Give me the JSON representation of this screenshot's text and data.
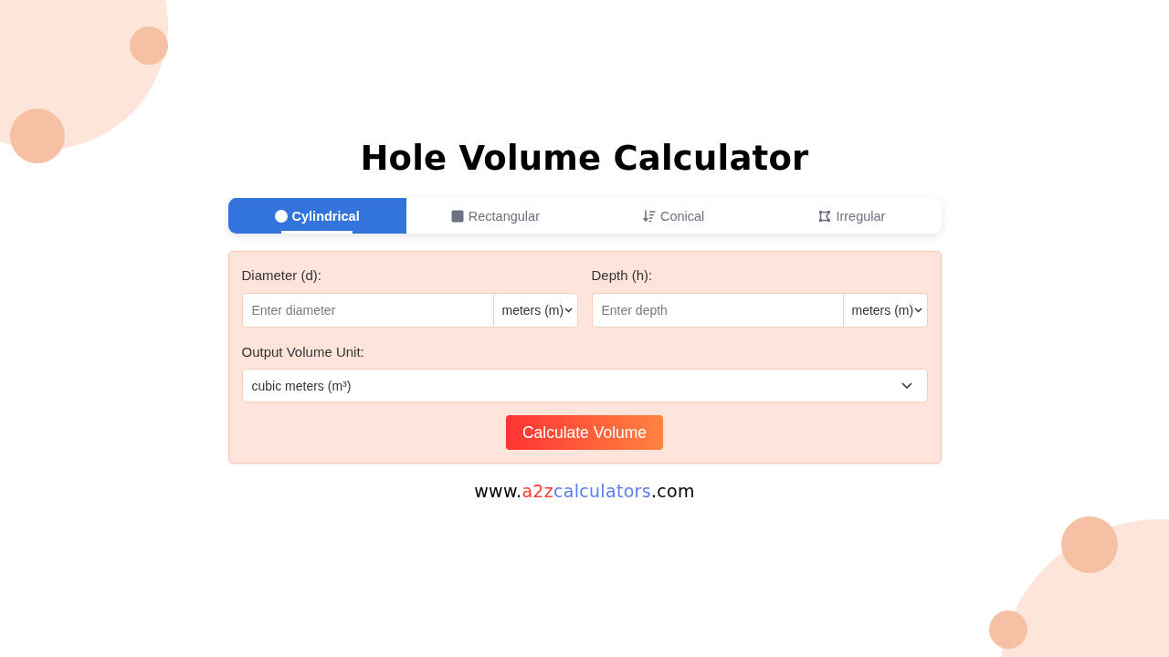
{
  "title": "Hole Volume Calculator",
  "tabs": [
    {
      "label": "Cylindrical",
      "selected": true
    },
    {
      "label": "Rectangular",
      "selected": false
    },
    {
      "label": "Conical",
      "selected": false
    },
    {
      "label": "Irregular",
      "selected": false
    }
  ],
  "form": {
    "fields": [
      {
        "label": "Diameter (d):",
        "placeholder": "Enter diameter",
        "unit": "meters (m)"
      },
      {
        "label": "Depth (h):",
        "placeholder": "Enter depth",
        "unit": "meters (m)"
      }
    ],
    "output_unit": {
      "label": "Output Volume Unit:",
      "value": "cubic meters (m³)"
    },
    "button": "Calculate Volume"
  },
  "footer": {
    "segments": [
      {
        "text": "www.",
        "color": "#000000"
      },
      {
        "text": "a2z",
        "color": "#ff3b30"
      },
      {
        "text": "calculators",
        "color": "#5b7cf0"
      },
      {
        "text": ".com",
        "color": "#000000"
      }
    ]
  }
}
